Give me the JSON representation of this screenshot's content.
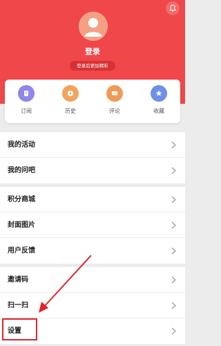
{
  "header": {
    "bg_color": "#f0474a",
    "title": "登录",
    "subtitle": "登录后更加精彩",
    "bell_icon": "bell-icon",
    "avatar_icon": "user-avatar-icon"
  },
  "quick_actions": [
    {
      "label": "订阅",
      "icon": "subscribe-icon",
      "color": "#8e86e8"
    },
    {
      "label": "历史",
      "icon": "history-icon",
      "color": "#f3a35e"
    },
    {
      "label": "评论",
      "icon": "comment-icon",
      "color": "#f09a5a"
    },
    {
      "label": "收藏",
      "icon": "star-icon",
      "color": "#6f8fe8"
    }
  ],
  "menu_groups": [
    [
      {
        "label": "我的活动"
      },
      {
        "label": "我的问吧"
      }
    ],
    [
      {
        "label": "积分商城"
      },
      {
        "label": "封面图片"
      },
      {
        "label": "用户反馈"
      }
    ],
    [
      {
        "label": "邀请码"
      },
      {
        "label": "扫一扫"
      },
      {
        "label": "设置"
      }
    ]
  ],
  "annotation": {
    "color": "#e0232a",
    "highlighted_item": "设置"
  }
}
